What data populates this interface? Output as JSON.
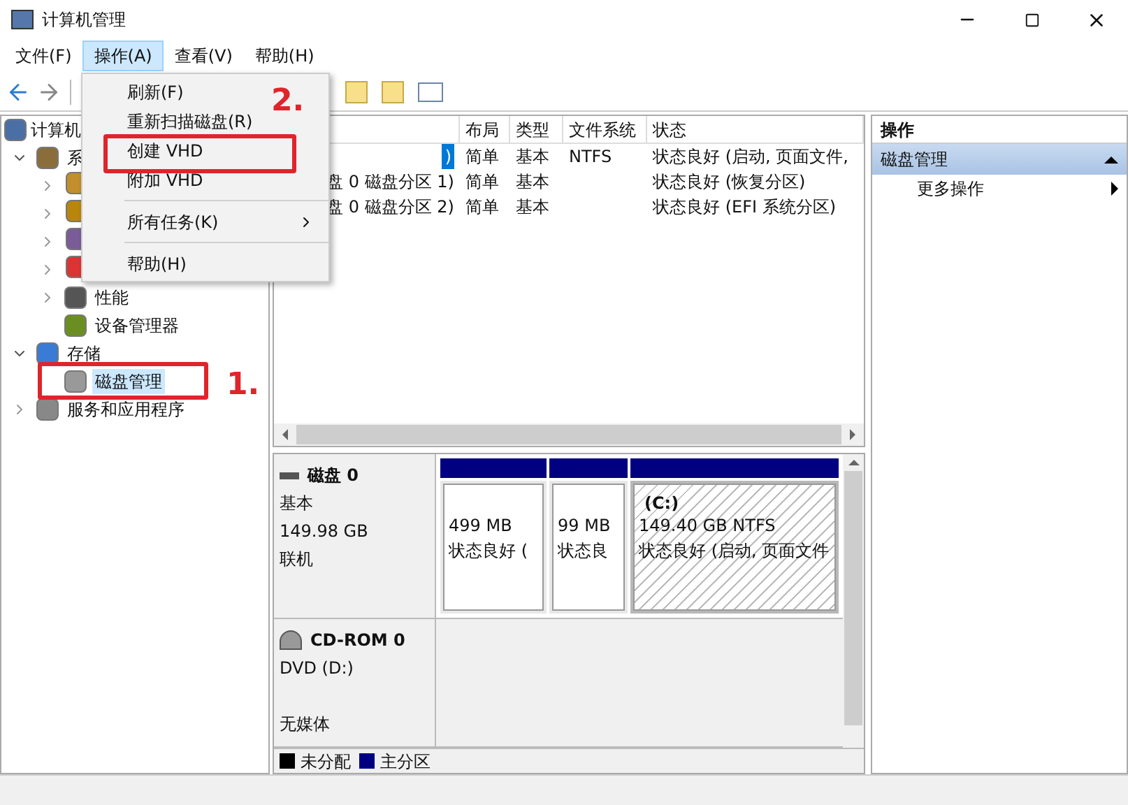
{
  "window": {
    "title": "计算机管理"
  },
  "menu_bar": [
    {
      "label": "文件(F)",
      "selected": false
    },
    {
      "label": "操作(A)",
      "selected": true
    },
    {
      "label": "查看(V)",
      "selected": false
    },
    {
      "label": "帮助(H)",
      "selected": false
    }
  ],
  "dropdown_menu": [
    {
      "kind": "item",
      "label": "刷新(F)"
    },
    {
      "kind": "item",
      "label": "重新扫描磁盘(R)"
    },
    {
      "kind": "item",
      "label": "创建 VHD"
    },
    {
      "kind": "item",
      "label": "附加 VHD"
    },
    {
      "kind": "separator"
    },
    {
      "kind": "submenu",
      "label": "所有任务(K)"
    },
    {
      "kind": "separator"
    },
    {
      "kind": "item",
      "label": "帮助(H)"
    }
  ],
  "tree": [
    {
      "label": "计算机",
      "selected": false,
      "children": [
        {
          "label": "系",
          "expanded": true,
          "selected": false,
          "children": [
            {
              "expanded": false,
              "selected": false
            },
            {
              "expanded": false,
              "selected": false
            },
            {
              "expanded": false,
              "selected": false
            },
            {
              "expanded": false,
              "selected": false
            },
            {
              "label": "性能",
              "expanded": false,
              "selected": false
            },
            {
              "label": "设备管理器",
              "selected": false
            }
          ]
        },
        {
          "label": "存储",
          "expanded": true,
          "selected": false,
          "children": [
            {
              "label": "磁盘管理",
              "selected": true
            }
          ]
        },
        {
          "label": "服务和应用程序",
          "expanded": false,
          "selected": false
        }
      ]
    }
  ],
  "volume_table": {
    "columns": [
      "",
      "布局",
      "类型",
      "文件系统",
      "状态"
    ],
    "rows": [
      {
        "column_1": ")",
        "layout": "简单",
        "type": "基本",
        "file_system": "NTFS",
        "status": "状态良好 (启动, 页面文件,",
        "selected": true
      },
      {
        "column_1": "盘 0 磁盘分区 1)",
        "layout": "简单",
        "type": "基本",
        "file_system": "",
        "status": "状态良好 (恢复分区)",
        "selected": false
      },
      {
        "column_1": "盘 0 磁盘分区 2)",
        "layout": "简单",
        "type": "基本",
        "file_system": "",
        "status": "状态良好 (EFI 系统分区)",
        "selected": false
      }
    ]
  },
  "disks": [
    {
      "kind": "disk",
      "name": "磁盘 0",
      "info": [
        "基本",
        "149.98 GB",
        "联机"
      ],
      "partitions": [
        {
          "size": "499 MB",
          "status": "状态良好 (",
          "selected": false
        },
        {
          "size": "99 MB",
          "status": "状态良",
          "selected": false
        },
        {
          "label": "(C:)",
          "size": "149.40 GB NTFS",
          "status": "状态良好 (启动, 页面文件",
          "selected": true
        }
      ]
    },
    {
      "kind": "cdrom",
      "name": "CD-ROM 0",
      "info": [
        "DVD (D:)",
        "无媒体"
      ]
    }
  ],
  "legend": [
    {
      "label": "未分配",
      "color": "#000000"
    },
    {
      "label": "主分区",
      "color": "#000080"
    }
  ],
  "actions_pane": {
    "title": "操作",
    "section": {
      "label": "磁盘管理",
      "expanded": true
    },
    "items": [
      "更多操作"
    ]
  },
  "annotations": [
    {
      "label": "1."
    },
    {
      "label": "2."
    }
  ]
}
